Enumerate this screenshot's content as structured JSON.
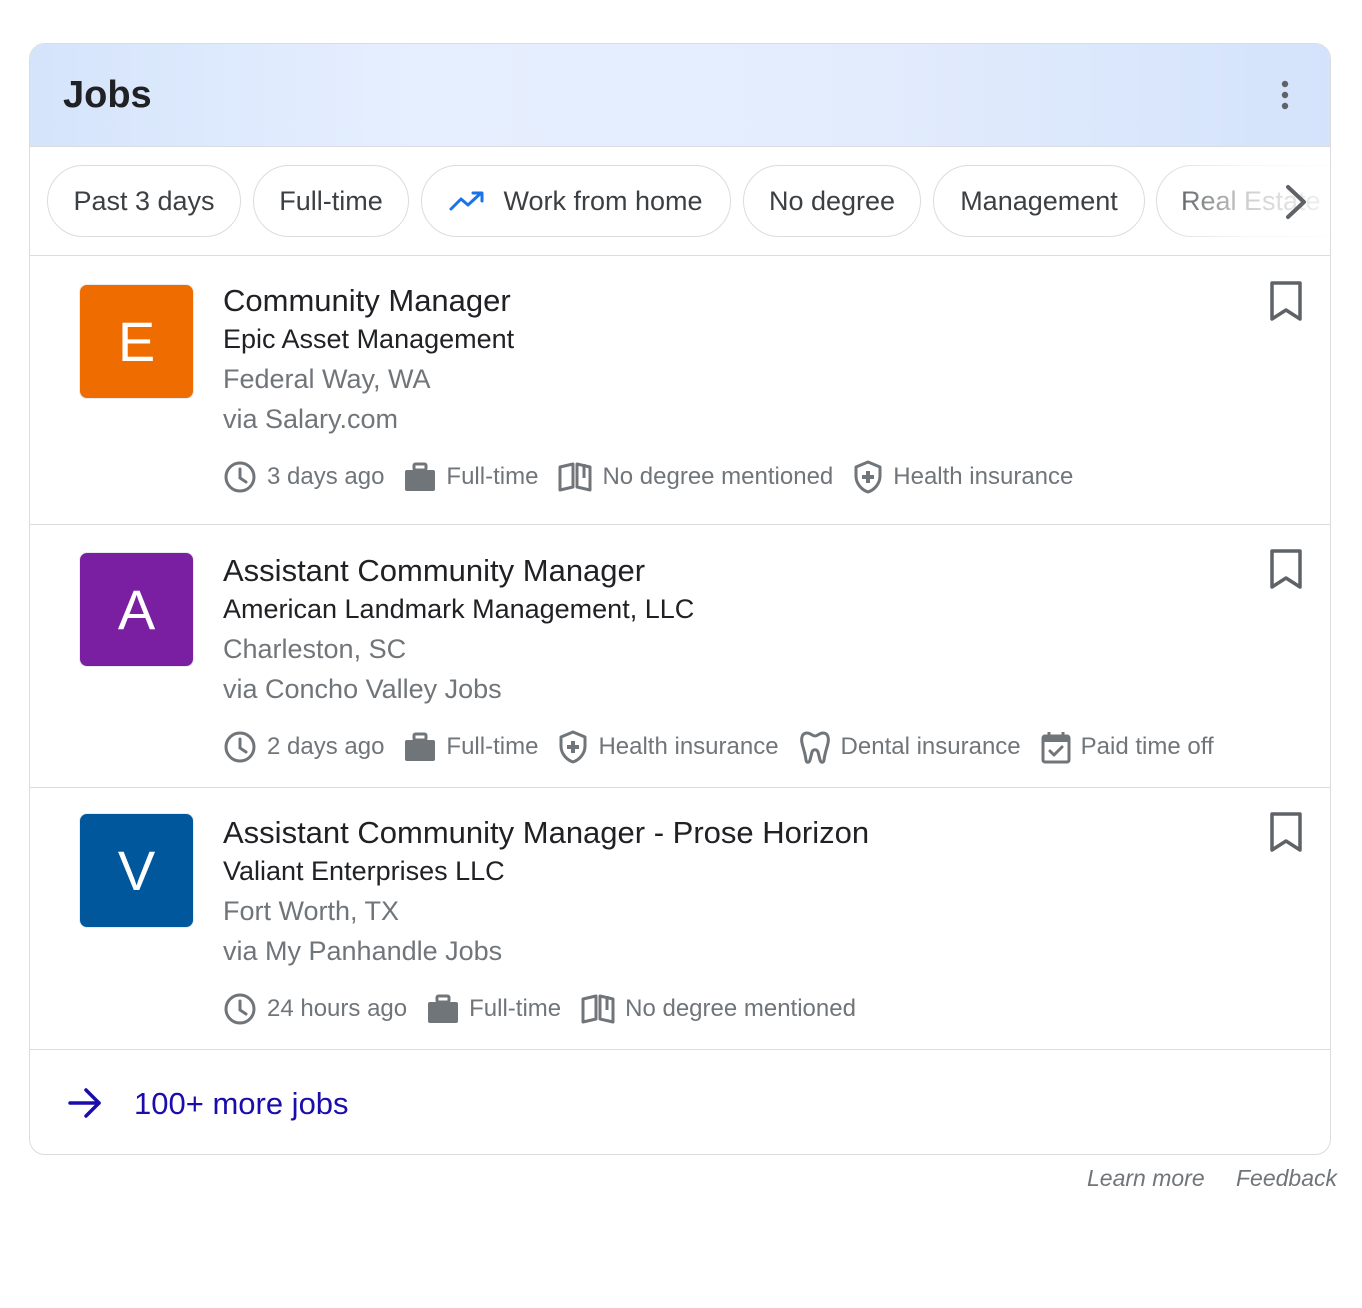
{
  "header": {
    "title": "Jobs"
  },
  "chips": [
    {
      "label": "Past 3 days"
    },
    {
      "label": "Full-time"
    },
    {
      "label": "Work from home",
      "icon": "trending-up-icon"
    },
    {
      "label": "No degree"
    },
    {
      "label": "Management"
    },
    {
      "label": "Real Estate"
    }
  ],
  "jobs": [
    {
      "logo_letter": "E",
      "logo_color": "#ef6c00",
      "title": "Community Manager",
      "company": "Epic Asset Management",
      "location": "Federal Way, WA",
      "via": "via Salary.com",
      "attributes": [
        {
          "icon": "clock-icon",
          "text": "3 days ago"
        },
        {
          "icon": "briefcase-icon",
          "text": "Full-time"
        },
        {
          "icon": "book-icon",
          "text": "No degree mentioned"
        },
        {
          "icon": "health-shield-icon",
          "text": "Health insurance"
        }
      ]
    },
    {
      "logo_letter": "A",
      "logo_color": "#7b1fa2",
      "title": "Assistant Community Manager",
      "company": "American Landmark Management, LLC",
      "location": "Charleston, SC",
      "via": "via Concho Valley Jobs",
      "attributes": [
        {
          "icon": "clock-icon",
          "text": "2 days ago"
        },
        {
          "icon": "briefcase-icon",
          "text": "Full-time"
        },
        {
          "icon": "health-shield-icon",
          "text": "Health insurance"
        },
        {
          "icon": "tooth-icon",
          "text": "Dental insurance"
        },
        {
          "icon": "calendar-check-icon",
          "text": "Paid time off"
        }
      ]
    },
    {
      "logo_letter": "V",
      "logo_color": "#01579b",
      "title": "Assistant Community Manager - Prose Horizon",
      "company": "Valiant Enterprises LLC",
      "location": "Fort Worth, TX",
      "via": "via My Panhandle Jobs",
      "attributes": [
        {
          "icon": "clock-icon",
          "text": "24 hours ago"
        },
        {
          "icon": "briefcase-icon",
          "text": "Full-time"
        },
        {
          "icon": "book-icon",
          "text": "No degree mentioned"
        }
      ]
    }
  ],
  "more_jobs": {
    "label": "100+ more jobs"
  },
  "footer": {
    "learn_more": "Learn more",
    "feedback": "Feedback"
  },
  "colors": {
    "link": "#1a0dab",
    "secondary_text": "#70757a",
    "border": "#dadce0"
  }
}
